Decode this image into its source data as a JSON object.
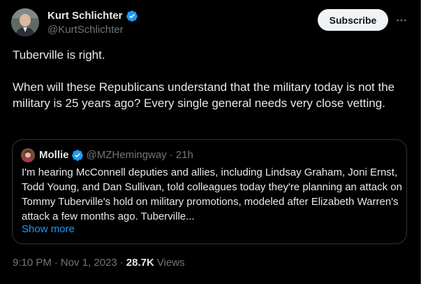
{
  "author": {
    "name": "Kurt Schlichter",
    "handle": "@KurtSchlichter"
  },
  "subscribe_label": "Subscribe",
  "more_icon": "more-horizontal-icon",
  "tweet": {
    "line1": "Tuberville is right.",
    "line2": "When will these Republicans understand that the military today is not the military is 25 years ago? Every single general needs very close vetting."
  },
  "quote": {
    "name": "Mollie",
    "handle": "@MZHemingway",
    "separator": "·",
    "time": "21h",
    "body": "I'm hearing McConnell deputies and allies, including Lindsay Graham, Joni Ernst, Todd Young, and Dan Sullivan, told colleagues today they're planning an attack on Tommy Tuberville's hold on military promotions, modeled after Elizabeth Warren's attack a few months ago. Tuberville...",
    "show_more": "Show more"
  },
  "footer": {
    "time": "9:10 PM",
    "sep1": "·",
    "date": "Nov 1, 2023",
    "sep2": "·",
    "views_count": "28.7K",
    "views_label": "Views"
  },
  "colors": {
    "background": "#000000",
    "text": "#e7e9ea",
    "secondary": "#71767b",
    "link": "#1d9bf0",
    "verified": "#1d9bf0",
    "border": "#2f3336",
    "button_bg": "#eff3f4"
  }
}
